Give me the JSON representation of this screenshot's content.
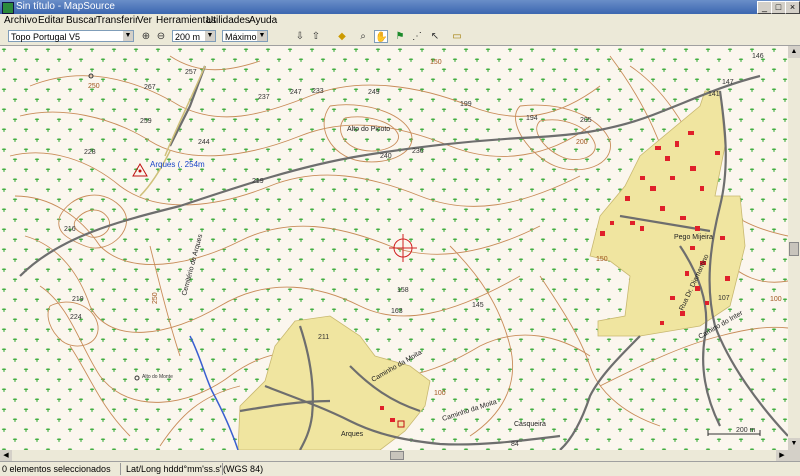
{
  "window": {
    "title": "Sin título - MapSource",
    "controls": [
      "_",
      "□",
      "×"
    ]
  },
  "menu": [
    "Archivo",
    "Editar",
    "Buscar",
    "Transferir",
    "Ver",
    "Herramientas",
    "Utilidades",
    "Ayuda"
  ],
  "toolbar": {
    "product": "Topo Portugal V5",
    "zoom_scale": "200 m",
    "detail_level": "Máximo"
  },
  "map": {
    "peak_label": "Arques (. 254m",
    "place_names": [
      "Alto do Picoto",
      "Pego Mijeira",
      "Arques",
      "Casqueira",
      "Cemitério de Arques",
      "Rua Dr. Diamantino",
      "Caminho da Moita",
      "Caminho da Moita",
      "Alto do Monte",
      "Camino do Inter"
    ],
    "spot_heights": [
      "257",
      "267",
      "237",
      "247",
      "233",
      "249",
      "259",
      "228",
      "244",
      "219",
      "240",
      "236",
      "216",
      "219",
      "224",
      "199",
      "194",
      "205",
      "146",
      "147",
      "141",
      "158",
      "163",
      "145",
      "107",
      "84",
      "211"
    ],
    "contour_labels": [
      "150",
      "200",
      "250",
      "150",
      "100",
      "100",
      "250"
    ],
    "scale_label": "200 m"
  },
  "status": {
    "selection": "0 elementos seleccionados",
    "coord_format": "Lat/Long hddd°mm'ss.s\"(WGS 84)"
  },
  "colors": {
    "map_bg": "#fbf6ee",
    "urban": "#f0e5a0",
    "road": "#6e6e6e",
    "contour": "#c88c5a",
    "forest_symbol": "#3fae3f",
    "river": "#3a5fd0",
    "building": "#e0202a"
  }
}
